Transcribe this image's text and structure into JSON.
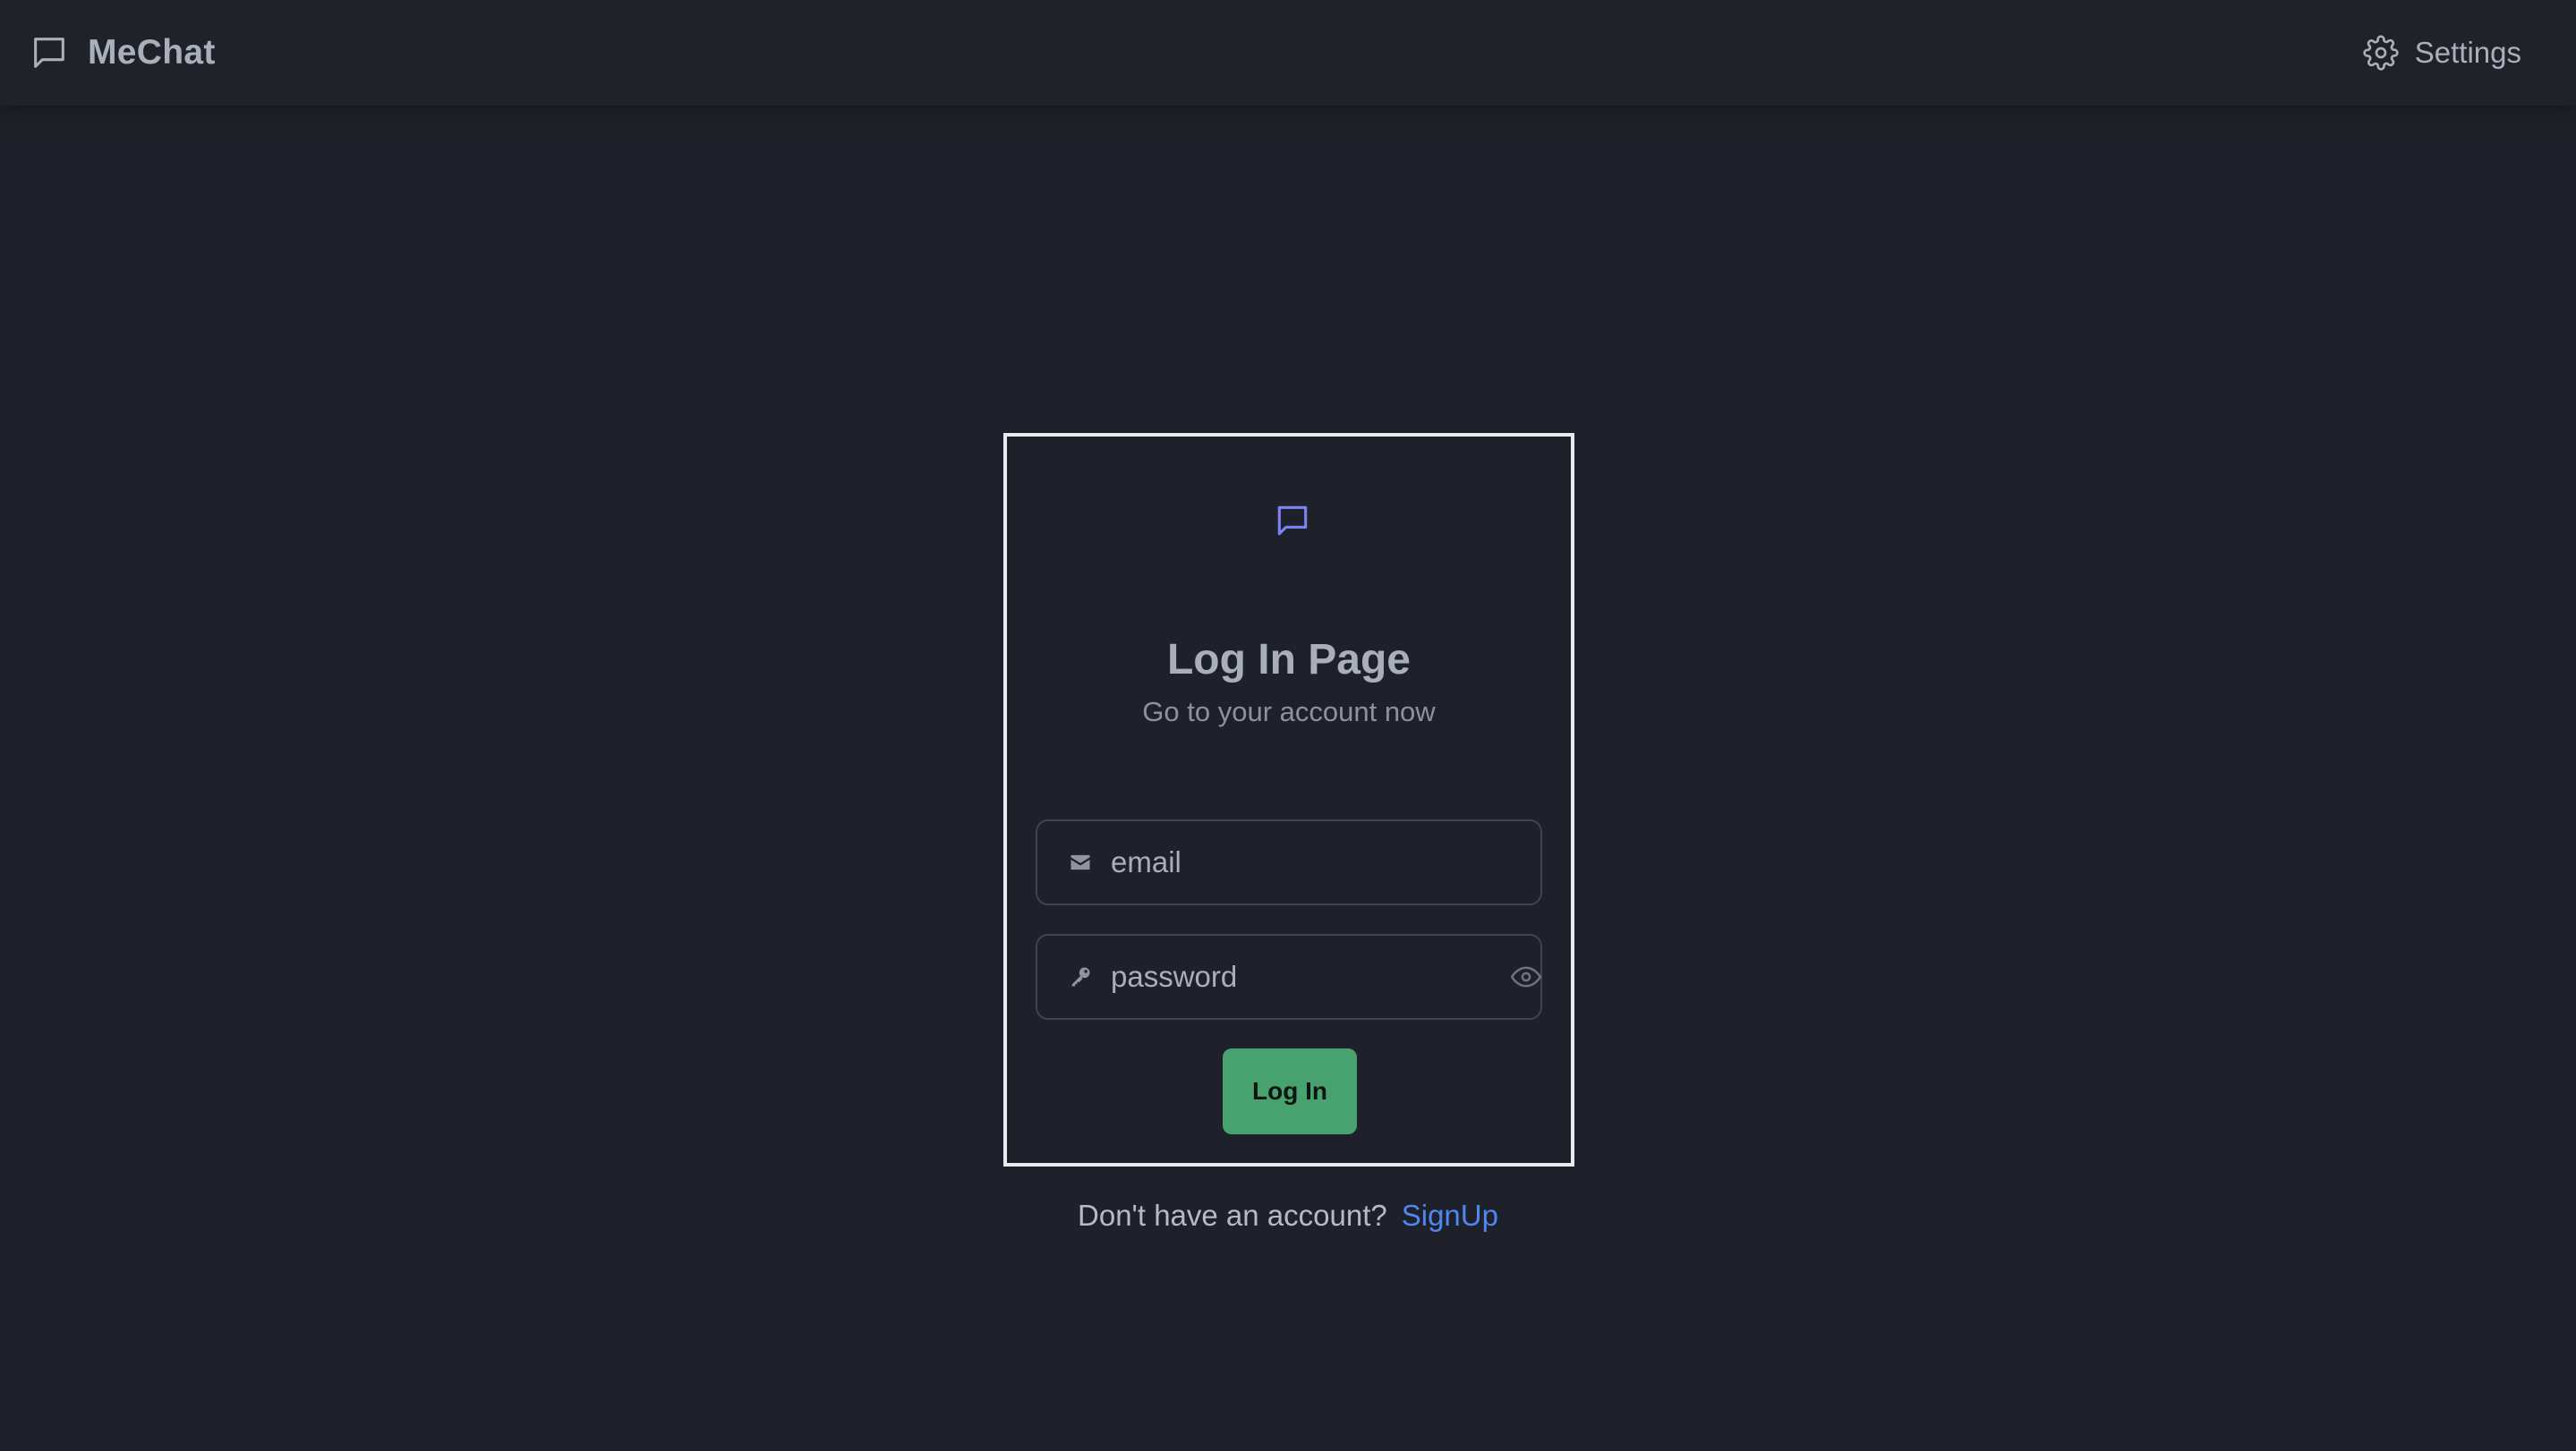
{
  "app": {
    "name": "MeChat"
  },
  "header": {
    "brand_icon": "chat-bubble-icon",
    "settings_icon": "gear-icon",
    "settings_label": "Settings"
  },
  "login": {
    "logo_icon": "chat-bubble-icon",
    "title": "Log In Page",
    "subtitle": "Go to your account now",
    "email": {
      "icon": "envelope-icon",
      "placeholder": "email",
      "value": ""
    },
    "password": {
      "icon": "key-icon",
      "placeholder": "password",
      "value": "",
      "toggle_icon": "eye-icon"
    },
    "submit_label": "Log In"
  },
  "footer": {
    "prompt": "Don't have an account?",
    "link_label": "SignUp"
  },
  "colors": {
    "background": "#1e2129",
    "accent_icon": "#7b84f2",
    "button": "#48a26f",
    "link": "#4f86f0"
  }
}
